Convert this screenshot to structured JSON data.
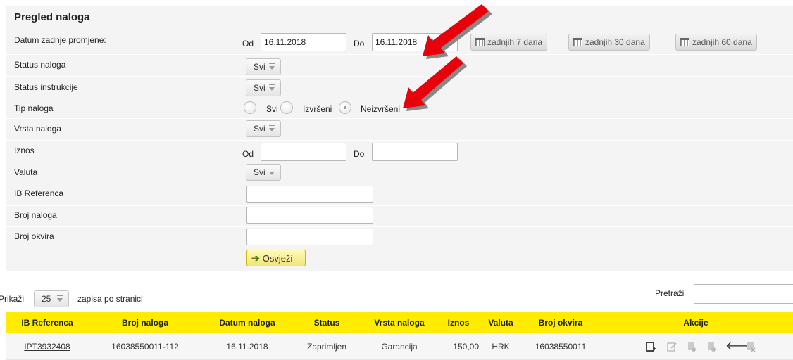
{
  "panel": {
    "title": "Pregled naloga",
    "refresh_label": "Osvježi"
  },
  "filters": {
    "datum_label": "Datum zadnje promjene:",
    "od": "Od",
    "do": "Do",
    "date_from": "16.11.2018",
    "date_to": "16.11.2018",
    "quick_7": "zadnjih 7 dana",
    "quick_30": "zadnjih 30 dana",
    "quick_60": "zadnjih 60 dana",
    "status_naloga": "Status naloga",
    "status_instrukcije": "Status instrukcije",
    "tip_naloga": "Tip naloga",
    "vrsta_naloga": "Vrsta naloga",
    "iznos": "Iznos",
    "valuta": "Valuta",
    "ib_referenca": "IB Referenca",
    "broj_naloga": "Broj naloga",
    "broj_okvira": "Broj okvira",
    "svi": "Svi",
    "tip_options": [
      "Svi",
      "Izvršeni",
      "Neizvršeni"
    ],
    "tip_selected": "Neizvršeni"
  },
  "list": {
    "prikazi": "Prikaži",
    "page_size": "25",
    "per_page_text": "zapisa po stranici",
    "search_label": "Pretraži"
  },
  "table": {
    "headers": [
      "IB Referenca",
      "Broj naloga",
      "Datum naloga",
      "Status",
      "Vrsta naloga",
      "Iznos",
      "Valuta",
      "Broj okvira",
      "Akcije"
    ],
    "rows": [
      {
        "ib_referenca": "IPT3932408",
        "broj_naloga": "16038550011-112",
        "datum_naloga": "16.11.2018",
        "status": "Zaprimljen",
        "vrsta_naloga": "Garancija",
        "iznos": "150,00",
        "valuta": "HRK",
        "broj_okvira": "16038550011"
      }
    ],
    "action_icons": [
      "new-document-icon",
      "edit-icon",
      "document-icon",
      "document-icon",
      "back-arrow-icon",
      "cancel-document-icon"
    ]
  },
  "colors": {
    "table_header": "#ffec00",
    "annotation_arrow": "#e8000b"
  }
}
